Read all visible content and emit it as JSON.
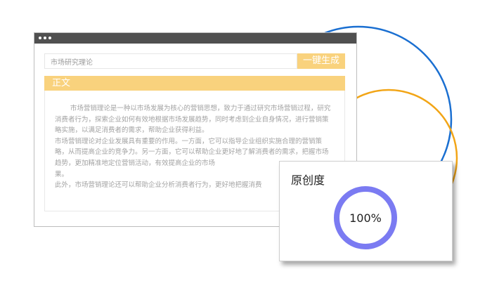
{
  "toolbar": {
    "search_value": "市场研究理论",
    "generate_label": "一键生成"
  },
  "section": {
    "title": "正文",
    "paragraphs": [
      "市场营销理论是一种以市场发展为核心的营销思想，致力于通过研究市场营销过程，研究消费者行为，探索企业如何有效地根据市场发展趋势，同时考虑到企业自身情况，进行营销策略实施，以满足消费者的需求，帮助企业获得利益。",
      "市场营销理论对企业发展具有重要的作用。一方面，它可以指导企业组织实施合理的营销策略，从而提高企业的竞争力。另一方面，它可以帮助企业更好地了解消费者的需求，把握市场趋势，更加精准地定位营销活动，有效提高企业的市场",
      "果。",
      "此外，市场营销理论还可以帮助企业分析消费者行为，更好地把握消费"
    ]
  },
  "originality": {
    "title": "原创度",
    "value_label": "100%",
    "value": 1.0
  },
  "colors": {
    "accent": "#f9d27d",
    "gauge": "#7b7bf2",
    "arc_blue": "#1a6fd1",
    "arc_orange": "#f2a516",
    "titlebar": "#505050"
  }
}
